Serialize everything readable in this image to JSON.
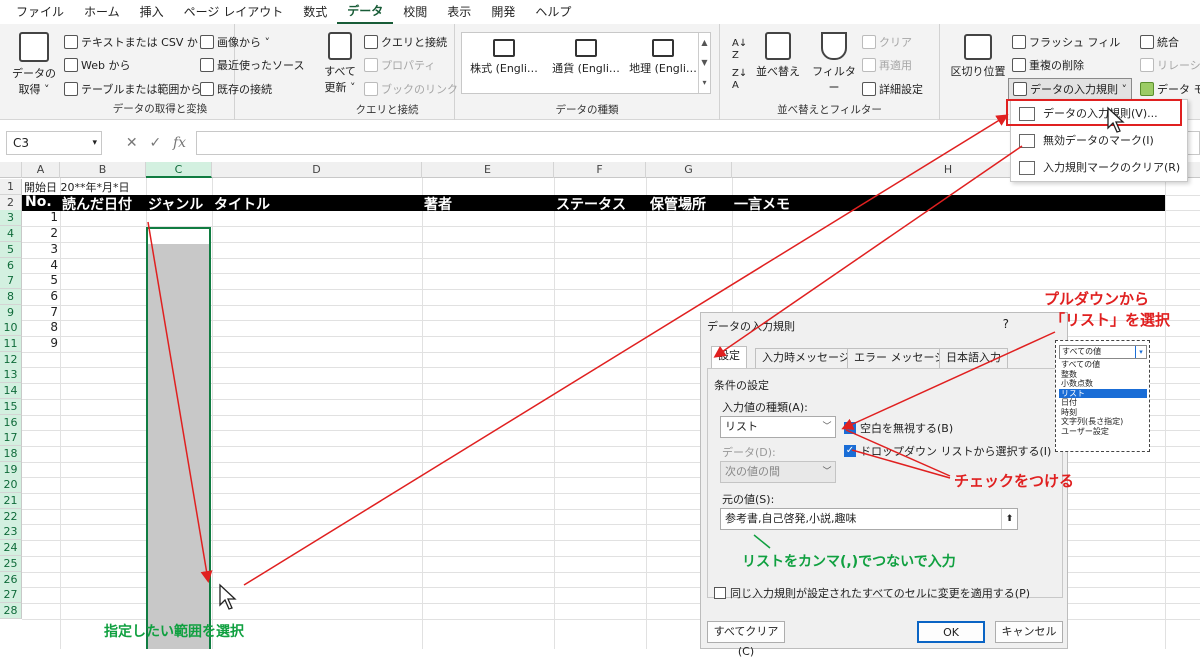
{
  "menu_tabs": [
    "ファイル",
    "ホーム",
    "挿入",
    "ページ レイアウト",
    "数式",
    "データ",
    "校閲",
    "表示",
    "開発",
    "ヘルプ"
  ],
  "active_tab": "データ",
  "ribbon": {
    "get_data": {
      "big_label1": "データの",
      "big_label2": "取得 ˅",
      "text_csv": "テキストまたは CSV から",
      "web": "Web から",
      "table_range": "テーブルまたは範囲から",
      "images": "画像から ˅",
      "recent": "最近使ったソース",
      "existing": "既存の接続",
      "group_label": "データの取得と変換"
    },
    "queries": {
      "refresh1": "すべて",
      "refresh2": "更新 ˅",
      "queries_conn": "クエリと接続",
      "properties": "プロパティ",
      "links": "ブックのリンク",
      "group_label": "クエリと接続"
    },
    "data_types": {
      "stocks": "株式 (Engli…",
      "currency": "通貨 (Engli…",
      "geo": "地理 (Engli…",
      "group_label": "データの種類"
    },
    "sort_filter": {
      "sort": "並べ替え",
      "filter": "フィルター",
      "clear": "クリア",
      "reapply": "再適用",
      "advanced": "詳細設定",
      "group_label": "並べ替えとフィルター"
    },
    "tools": {
      "text_to_cols": "区切り位置",
      "flash_fill": "フラッシュ フィル",
      "remove_dup": "重複の削除",
      "validation": "データの入力規則 ˅",
      "consolidate": "統合",
      "relationships": "リレーショ",
      "data_model": "データ モ"
    }
  },
  "validation_menu": {
    "item1": "データの入力規則(V)...",
    "item2": "無効データのマーク(I)",
    "item3": "入力規則マークのクリア(R)"
  },
  "formula_bar": {
    "name_box": "C3",
    "fx": "fx"
  },
  "columns": [
    "A",
    "B",
    "C",
    "D",
    "E",
    "F",
    "G",
    "H"
  ],
  "rows": [
    "1",
    "2",
    "3",
    "4",
    "5",
    "6",
    "7",
    "8",
    "9",
    "10",
    "11",
    "12",
    "13",
    "14",
    "15",
    "16",
    "17",
    "18",
    "19",
    "20",
    "21",
    "22",
    "23",
    "24",
    "25",
    "26",
    "27",
    "28"
  ],
  "cell_a1": "開始日 20**年*月*日",
  "header_row": {
    "no": "No.",
    "date": "読んだ日付",
    "genre": "ジャンル",
    "title": "タイトル",
    "author": "著者",
    "status": "ステータス",
    "location": "保管場所",
    "memo": "一言メモ"
  },
  "numbers": [
    "1",
    "2",
    "3",
    "4",
    "5",
    "6",
    "7",
    "8",
    "9"
  ],
  "dialog": {
    "title": "データの入力規則",
    "help": "?",
    "tabs": [
      "設定",
      "入力時メッセージ",
      "エラー メッセージ",
      "日本語入力"
    ],
    "conditions": "条件の設定",
    "allow_label": "入力値の種類(A):",
    "allow_value": "リスト",
    "data_label": "データ(D):",
    "data_value": "次の値の間",
    "ignore_blank": "空白を無視する(B)",
    "dropdown": "ドロップダウン リストから選択する(I)",
    "source_label": "元の値(S):",
    "source_value": "参考書,自己啓発,小説,趣味",
    "apply_all": "同じ入力規則が設定されたすべてのセルに変更を適用する(P)",
    "clear_all": "すべてクリア(C)",
    "ok": "OK",
    "cancel": "キャンセル"
  },
  "list_popup": {
    "selected": "すべての値",
    "items": [
      "すべての値",
      "整数",
      "小数点数",
      "リスト",
      "日付",
      "時刻",
      "文字列(長さ指定)",
      "ユーザー設定"
    ],
    "highlighted_index": 3
  },
  "annotations": {
    "pulldown1": "プルダウンから",
    "pulldown2": "「リスト」を選択",
    "check": "チェックをつける",
    "comma": "リストをカンマ(,)でつないで入力",
    "range": "指定したい範囲を選択"
  },
  "colors": {
    "accent_green": "#107c41",
    "annotation_red": "#e02020",
    "annotation_green": "#10a040",
    "highlight_blue": "#1a6dd6"
  }
}
